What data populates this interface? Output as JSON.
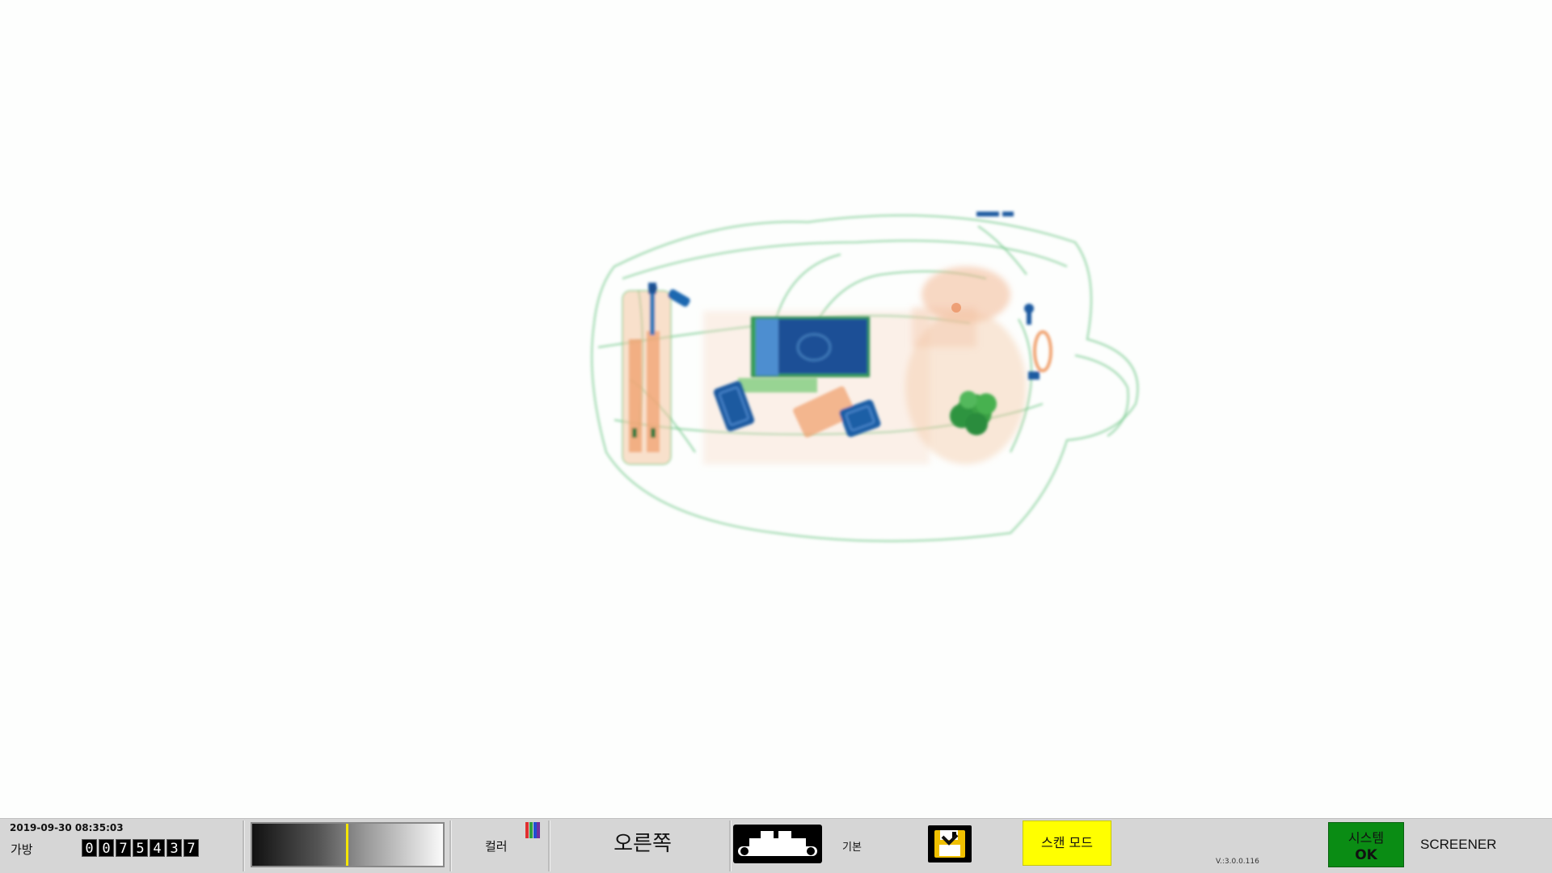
{
  "xray": {
    "description_icon": "xray-bag-image"
  },
  "status_bar": {
    "datetime": "2019-09-30 08:35:03",
    "bag_label": "가방",
    "bag_counter_digits": [
      "0",
      "0",
      "7",
      "5",
      "4",
      "3",
      "7"
    ],
    "contrast_level": 0.49,
    "color_mode_label": "컬러",
    "color_icon": "color-bars-icon",
    "direction_label": "오른쪽",
    "conveyor_icon": "conveyor-belt-icon",
    "basic_label": "기본",
    "save_icon": "save-disk-icon",
    "scan_mode_label": "스캔 모드",
    "version": "V.:3.0.0.116",
    "system_status_line1": "시스템",
    "system_status_line2": "OK",
    "system_status_color": "#0a8c14",
    "user_role": "SCREENER"
  },
  "colors": {
    "organic_orange": "#f0a070",
    "inorganic_green": "#3cb050",
    "metal_blue": "#1a5aa0",
    "scan_mode_yellow": "#ffff00"
  }
}
